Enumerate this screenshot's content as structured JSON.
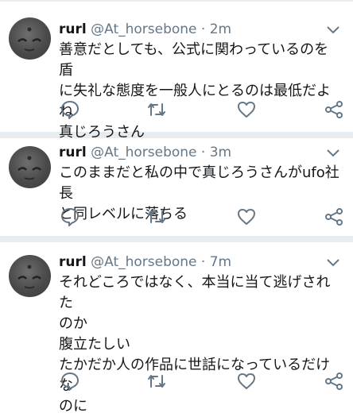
{
  "tweets": [
    {
      "name": "rurl",
      "handle": "@At_horsebone",
      "time": "2m",
      "text": "善意だとしても、公式に関わっているのを盾\nに失礼な態度を一般人にとるのは最低だよね\n真じろうさん"
    },
    {
      "name": "rurl",
      "handle": "@At_horsebone",
      "time": "3m",
      "text": "このままだと私の中で真じろうさんがufo社長\nと同レベルに落ちる"
    },
    {
      "name": "rurl",
      "handle": "@At_horsebone",
      "time": "7m",
      "text": "それどころではなく、本当に当て逃げされた\nのか\n腹立たしい\nたかだか人の作品に世話になっているだけな\nのに"
    }
  ],
  "separator": " · ",
  "icons": {
    "avatar": "avatar-image",
    "more": "chevron-down-icon",
    "reply": "reply-icon",
    "retweet": "retweet-icon",
    "like": "heart-icon",
    "share": "share-icon"
  },
  "colors": {
    "icon_gray": "#657786",
    "separator": "#e6ecf0",
    "text": "#14171a"
  }
}
